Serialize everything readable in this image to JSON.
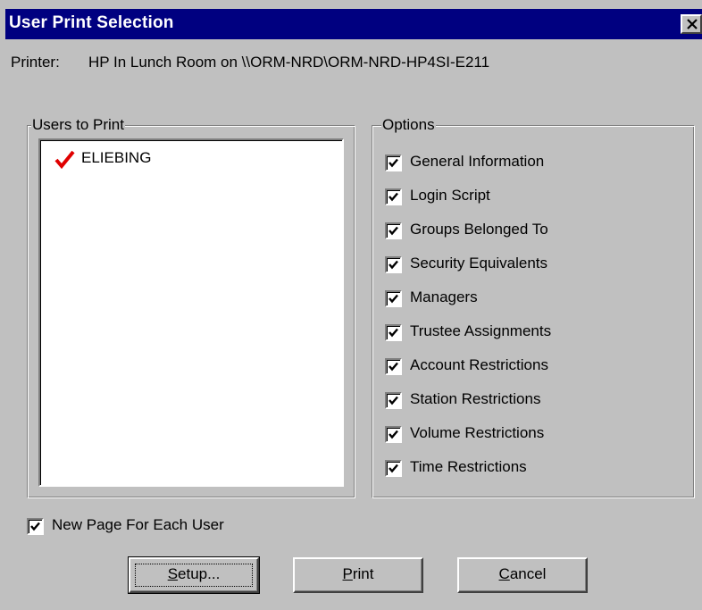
{
  "window": {
    "title": "User Print Selection"
  },
  "printer": {
    "label": "Printer:",
    "name": "HP In Lunch Room on \\\\ORM-NRD\\ORM-NRD-HP4SI-E211"
  },
  "users_group": {
    "legend": "Users to Print",
    "items": [
      {
        "name": "ELIEBING",
        "checked": true,
        "check_color": "#e00000"
      }
    ]
  },
  "options_group": {
    "legend": "Options",
    "items": [
      {
        "label": "General Information",
        "checked": true
      },
      {
        "label": "Login Script",
        "checked": true
      },
      {
        "label": "Groups Belonged To",
        "checked": true
      },
      {
        "label": "Security Equivalents",
        "checked": true
      },
      {
        "label": "Managers",
        "checked": true
      },
      {
        "label": "Trustee Assignments",
        "checked": true
      },
      {
        "label": "Account Restrictions",
        "checked": true
      },
      {
        "label": "Station Restrictions",
        "checked": true
      },
      {
        "label": "Volume Restrictions",
        "checked": true
      },
      {
        "label": "Time Restrictions",
        "checked": true
      }
    ]
  },
  "new_page": {
    "label": "New Page For Each User",
    "checked": true
  },
  "buttons": {
    "setup": {
      "accel": "S",
      "rest": "etup..."
    },
    "print": {
      "accel": "P",
      "rest": "rint"
    },
    "cancel": {
      "accel": "C",
      "rest": "ancel"
    }
  },
  "colors": {
    "titlebar": "#000080",
    "face": "#c0c0c0",
    "check_mark": "#e00000"
  }
}
